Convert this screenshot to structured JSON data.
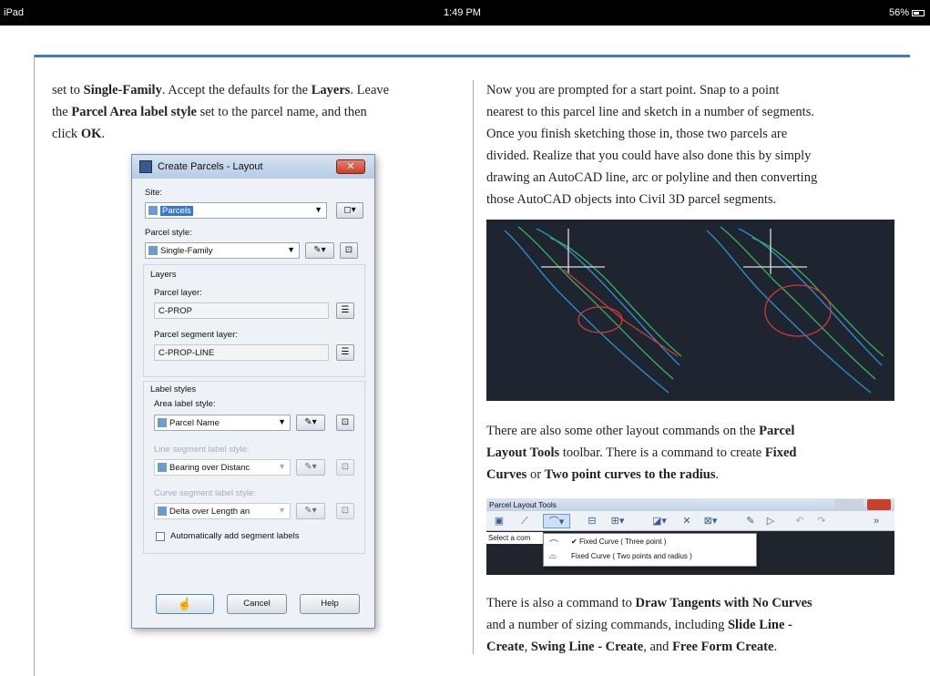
{
  "status_bar": {
    "device": "iPad",
    "time": "1:49 PM",
    "battery": "56%"
  },
  "left_intro": {
    "l1_a": "set to ",
    "l1_b": "Single-Family",
    "l1_c": ". Accept the defaults for the ",
    "l1_d": "Layers",
    "l1_e": ". Leave",
    "l2_a": "the ",
    "l2_b": "Parcel Area label style",
    "l2_c": " set to the parcel name, and then",
    "l3_a": "click ",
    "l3_b": "OK",
    "l3_c": "."
  },
  "dialog": {
    "title": "Create Parcels - Layout",
    "site_label": "Site:",
    "site_value": "Parcels",
    "parcel_style_label": "Parcel style:",
    "parcel_style_value": "Single-Family",
    "layers_heading": "Layers",
    "parcel_layer_label": "Parcel layer:",
    "parcel_layer_value": "C-PROP",
    "segment_layer_label": "Parcel segment layer:",
    "segment_layer_value": "C-PROP-LINE",
    "label_styles_heading": "Label styles",
    "area_label_label": "Area label style:",
    "area_label_value": "Parcel Name",
    "line_segment_label": "Line segment label style:",
    "line_segment_value": "Bearing over Distanc",
    "curve_segment_label": "Curve segment label style:",
    "curve_segment_value": "Delta over Length an",
    "auto_add_label": "Automatically add segment labels",
    "cancel": "Cancel",
    "help": "Help"
  },
  "right_para1": {
    "l1": "Now you are prompted for a start point. Snap to a point",
    "l2": "nearest to this parcel line and sketch in a number of segments.",
    "l3": "Once you finish sketching those in, those two parcels are",
    "l4": "divided. Realize that you could have also done this by simply",
    "l5": "drawing an AutoCAD line, arc or polyline and then converting",
    "l6": "those AutoCAD objects into Civil 3D parcel segments."
  },
  "right_para2": {
    "l1_a": "There are also some other layout commands on the ",
    "l1_b": "Parcel",
    "l2_a": "Layout Tools",
    "l2_b": " toolbar. There is a command to create ",
    "l2_c": "Fixed",
    "l3_a": "Curves",
    "l3_b": " or ",
    "l3_c": "Two point curves to the radius",
    "l3_d": "."
  },
  "toolbar": {
    "title": "Parcel Layout Tools",
    "prompt": "Select a com",
    "menu_item_1": "Fixed Curve ( Three point )",
    "menu_item_2": "Fixed Curve ( Two points and radius )"
  },
  "right_para3": {
    "l1_a": "There is also a command to ",
    "l1_b": "Draw Tangents with No Curves",
    "l2_a": "and a number of sizing commands, including ",
    "l2_b": "Slide Line -",
    "l3_a": "Create",
    "l3_b": ", ",
    "l3_c": "Swing Line - Create",
    "l3_d": ", and ",
    "l3_e": "Free Form Create",
    "l3_f": "."
  },
  "colors": {
    "accent_rule": "#3d7cc8",
    "cad_background": "#1f2530",
    "close_red": "#c8402a"
  }
}
